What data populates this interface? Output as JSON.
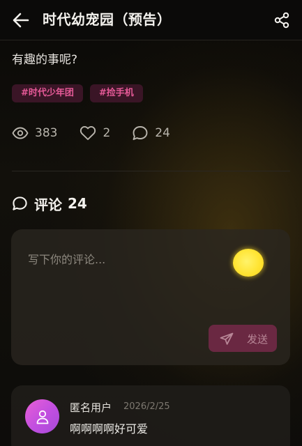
{
  "header": {
    "title": "时代幼宠园（预告）",
    "back_icon": "arrow-left-icon",
    "share_icon": "share-icon"
  },
  "post": {
    "text_tail": "有趣的事呢?",
    "tags": [
      "#时代少年团",
      "#捡手机"
    ],
    "stats": {
      "views": "383",
      "likes": "2",
      "comments": "24"
    }
  },
  "comments": {
    "label": "评论",
    "count": "24",
    "input_placeholder": "写下你的评论...",
    "send_label": "发送",
    "list": [
      {
        "user": "匿名用户",
        "date": "2026/2/25",
        "text": "啊啊啊啊好可爱"
      }
    ]
  },
  "colors": {
    "accent": "#e65a98",
    "tag_bg": "#3a1526",
    "send_bg": "#6a2842"
  }
}
